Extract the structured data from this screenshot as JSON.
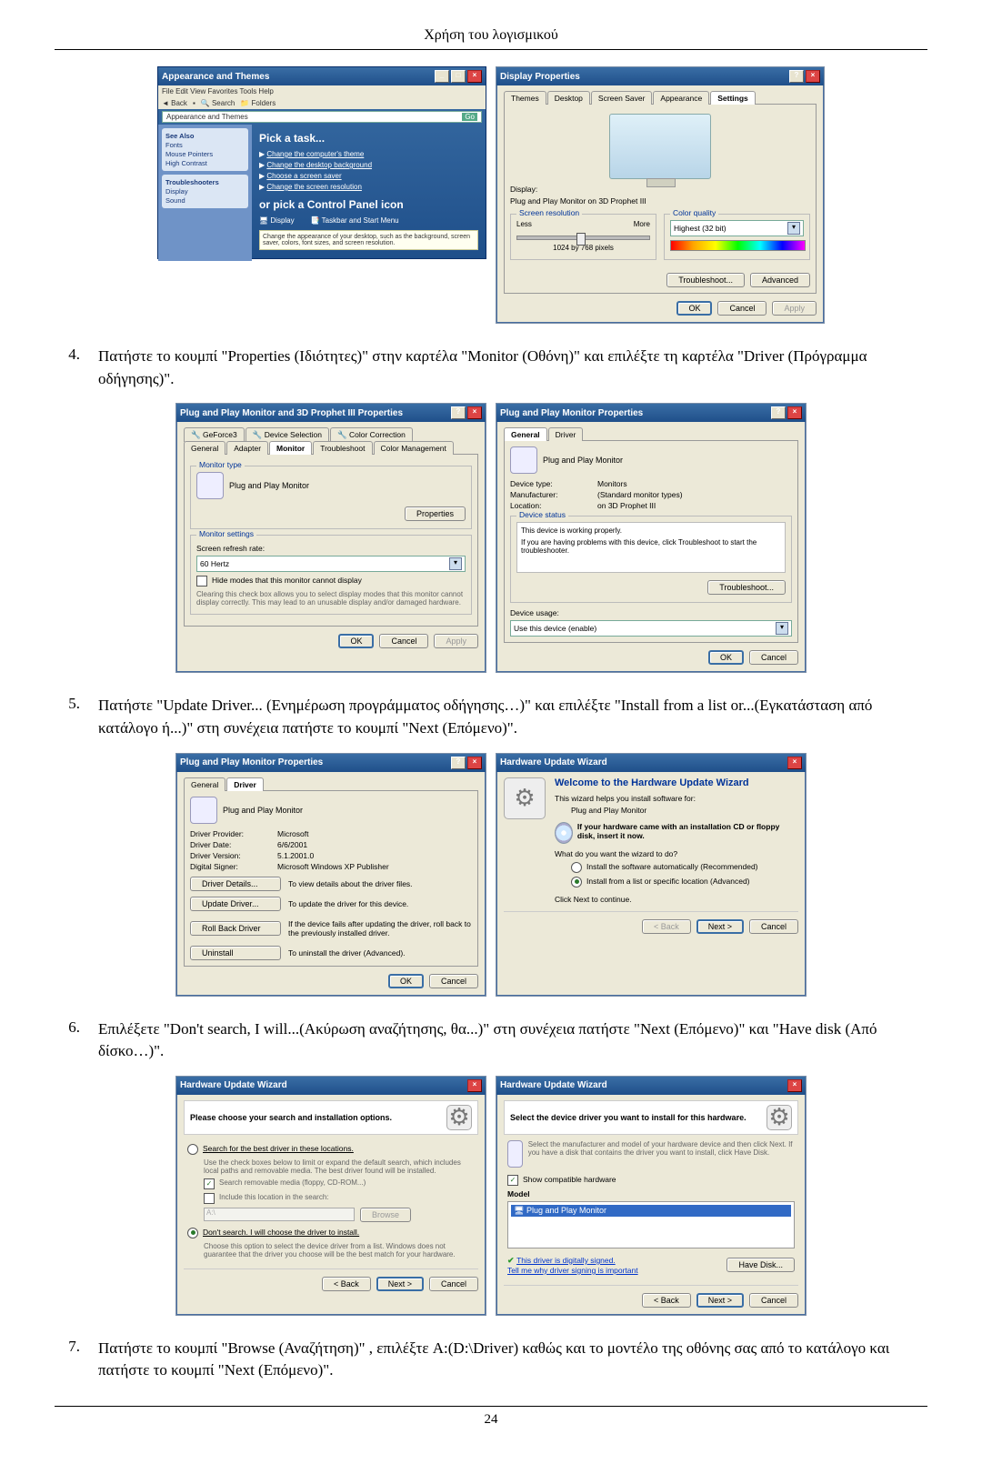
{
  "header": "Χρήση του λογισμικού",
  "pageNumber": "24",
  "steps": {
    "s4": {
      "num": "4.",
      "text": "Πατήστε το κουμπί \"Properties (Ιδιότητες)\" στην καρτέλα \"Monitor (Οθόνη)\" και επιλέξτε τη καρτέλα \"Driver (Πρόγραμμα οδήγησης)\"."
    },
    "s5": {
      "num": "5.",
      "text": "Πατήστε \"Update Driver... (Ενημέρωση προγράμματος οδήγησης…)\" και επιλέξτε \"Install from a list or...(Εγκατάσταση από κατάλογο ή...)\" στη συνέχεια πατήστε το κουμπί \"Next (Επόμενο)\"."
    },
    "s6": {
      "num": "6.",
      "text": "Επιλέξετε \"Don't search, I will...(Ακύρωση αναζήτησης, θα...)\" στη συνέχεια πατήστε \"Next (Επόμενο)\" και \"Have disk (Από δίσκο…)\"."
    },
    "s7": {
      "num": "7.",
      "text": "Πατήστε το κουμπί \"Browse (Αναζήτηση)\" , επιλέξτε A:(D:\\Driver) καθώς και το μοντέλο της οθόνης σας από το κατάλογο και πατήστε το κουμπί \"Next (Επόμενο)\"."
    }
  },
  "fig1": {
    "cp": {
      "title": "Appearance and Themes",
      "menu": "File  Edit  View  Favorites  Tools  Help",
      "back": "Back",
      "search": "Search",
      "folders": "Folders",
      "addr": "Appearance and Themes",
      "go": "Go",
      "side1_title": "See Also",
      "side1_items": [
        "Fonts",
        "Mouse Pointers",
        "High Contrast"
      ],
      "side2_title": "Troubleshooters",
      "side2_items": [
        "Display",
        "Sound"
      ],
      "main_title": "Appearance and Themes",
      "pick": "Pick a task...",
      "tasks": [
        "Change the computer's theme",
        "Change the desktop background",
        "Choose a screen saver",
        "Change the screen resolution"
      ],
      "orpick": "or pick a Control Panel icon",
      "icons": [
        "Display",
        "Taskbar and Start Menu"
      ],
      "desc": "Change the appearance of your desktop, such as the background, screen saver, colors, font sizes, and screen resolution."
    },
    "disp": {
      "title": "Display Properties",
      "tabs": [
        "Themes",
        "Desktop",
        "Screen Saver",
        "Appearance",
        "Settings"
      ],
      "activeTab": "Settings",
      "display_label": "Display:",
      "display_value": "Plug and Play Monitor on 3D Prophet III",
      "sr_label": "Screen resolution",
      "less": "Less",
      "more": "More",
      "res": "1024 by 768 pixels",
      "cq_label": "Color quality",
      "cq_value": "Highest (32 bit)",
      "troubleshoot": "Troubleshoot...",
      "advanced": "Advanced",
      "ok": "OK",
      "cancel": "Cancel",
      "apply": "Apply"
    }
  },
  "fig2": {
    "left": {
      "title": "Plug and Play Monitor and 3D Prophet III Properties",
      "tabs1": [
        "GeForce3",
        "Device Selection",
        "Color Correction"
      ],
      "tabs2": [
        "General",
        "Adapter",
        "Monitor",
        "Troubleshoot",
        "Color Management"
      ],
      "activeTab": "Monitor",
      "mt_label": "Monitor type",
      "mt_value": "Plug and Play Monitor",
      "properties": "Properties",
      "ms_label": "Monitor settings",
      "rr_label": "Screen refresh rate:",
      "rr_value": "60 Hertz",
      "hide": "Hide modes that this monitor cannot display",
      "hide_desc": "Clearing this check box allows you to select display modes that this monitor cannot display correctly. This may lead to an unusable display and/or damaged hardware.",
      "ok": "OK",
      "cancel": "Cancel",
      "apply": "Apply"
    },
    "right": {
      "title": "Plug and Play Monitor Properties",
      "tabs": [
        "General",
        "Driver"
      ],
      "activeTab": "General",
      "name": "Plug and Play Monitor",
      "dt_label": "Device type:",
      "dt_value": "Monitors",
      "mf_label": "Manufacturer:",
      "mf_value": "(Standard monitor types)",
      "loc_label": "Location:",
      "loc_value": "on 3D Prophet III",
      "ds_label": "Device status",
      "ds_text": "This device is working properly.",
      "ds_help": "If you are having problems with this device, click Troubleshoot to start the troubleshooter.",
      "troubleshoot": "Troubleshoot...",
      "du_label": "Device usage:",
      "du_value": "Use this device (enable)",
      "ok": "OK",
      "cancel": "Cancel"
    }
  },
  "fig3": {
    "left": {
      "title": "Plug and Play Monitor Properties",
      "tabs": [
        "General",
        "Driver"
      ],
      "activeTab": "Driver",
      "name": "Plug and Play Monitor",
      "dp_label": "Driver Provider:",
      "dp_value": "Microsoft",
      "dd_label": "Driver Date:",
      "dd_value": "6/6/2001",
      "dv_label": "Driver Version:",
      "dv_value": "5.1.2001.0",
      "ds_label": "Digital Signer:",
      "ds_value": "Microsoft Windows XP Publisher",
      "b1": "Driver Details...",
      "b1d": "To view details about the driver files.",
      "b2": "Update Driver...",
      "b2d": "To update the driver for this device.",
      "b3": "Roll Back Driver",
      "b3d": "If the device fails after updating the driver, roll back to the previously installed driver.",
      "b4": "Uninstall",
      "b4d": "To uninstall the driver (Advanced).",
      "ok": "OK",
      "cancel": "Cancel"
    },
    "right": {
      "title": "Hardware Update Wizard",
      "welcome": "Welcome to the Hardware Update Wizard",
      "help": "This wizard helps you install software for:",
      "device": "Plug and Play Monitor",
      "cd_text": "If your hardware came with an installation CD or floppy disk, insert it now.",
      "q": "What do you want the wizard to do?",
      "opt1": "Install the software automatically (Recommended)",
      "opt2": "Install from a list or specific location (Advanced)",
      "cont": "Click Next to continue.",
      "back": "< Back",
      "next": "Next >",
      "cancel": "Cancel"
    }
  },
  "fig4": {
    "left": {
      "title": "Hardware Update Wizard",
      "head": "Please choose your search and installation options.",
      "opt1": "Search for the best driver in these locations.",
      "opt1d": "Use the check boxes below to limit or expand the default search, which includes local paths and removable media. The best driver found will be installed.",
      "chk1": "Search removable media (floppy, CD-ROM...)",
      "chk2": "Include this location in the search:",
      "path": "A:\\",
      "browse": "Browse",
      "opt2": "Don't search. I will choose the driver to install.",
      "opt2d": "Choose this option to select the device driver from a list. Windows does not guarantee that the driver you choose will be the best match for your hardware.",
      "back": "< Back",
      "next": "Next >",
      "cancel": "Cancel"
    },
    "right": {
      "title": "Hardware Update Wizard",
      "head": "Select the device driver you want to install for this hardware.",
      "instr": "Select the manufacturer and model of your hardware device and then click Next. If you have a disk that contains the driver you want to install, click Have Disk.",
      "show": "Show compatible hardware",
      "model_label": "Model",
      "model": "Plug and Play Monitor",
      "signed": "This driver is digitally signed.",
      "why": "Tell me why driver signing is important",
      "havedisk": "Have Disk...",
      "back": "< Back",
      "next": "Next >",
      "cancel": "Cancel"
    }
  }
}
